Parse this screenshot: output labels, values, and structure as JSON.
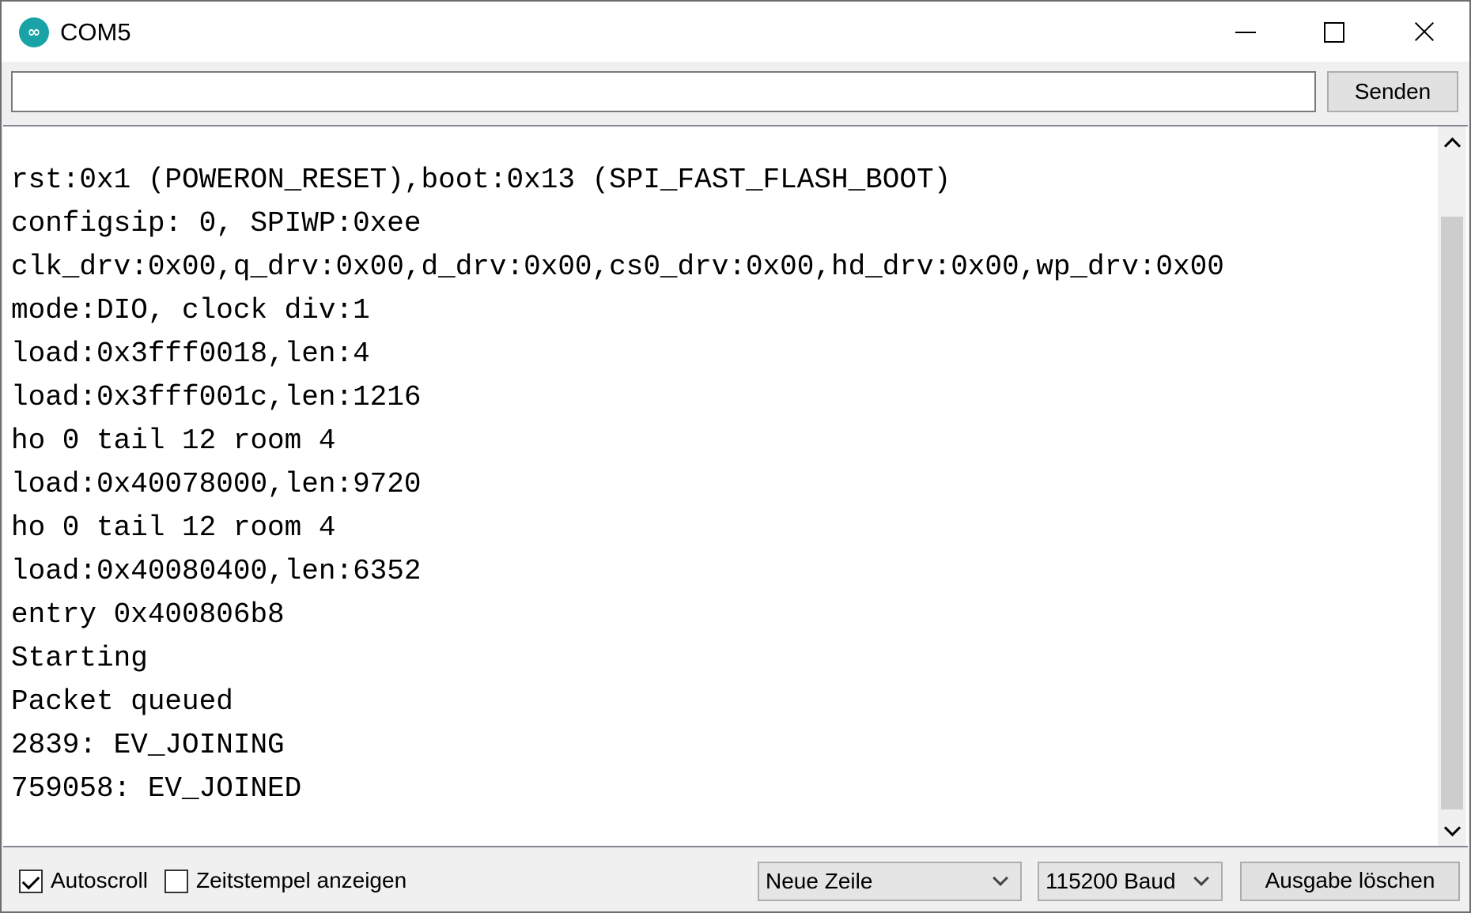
{
  "window": {
    "title": "COM5"
  },
  "toolbar": {
    "input_value": "",
    "send_label": "Senden"
  },
  "console": {
    "lines": [
      "rst:0x1 (POWERON_RESET),boot:0x13 (SPI_FAST_FLASH_BOOT)",
      "configsip: 0, SPIWP:0xee",
      "clk_drv:0x00,q_drv:0x00,d_drv:0x00,cs0_drv:0x00,hd_drv:0x00,wp_drv:0x00",
      "mode:DIO, clock div:1",
      "load:0x3fff0018,len:4",
      "load:0x3fff001c,len:1216",
      "ho 0 tail 12 room 4",
      "load:0x40078000,len:9720",
      "ho 0 tail 12 room 4",
      "load:0x40080400,len:6352",
      "entry 0x400806b8",
      "Starting",
      "Packet queued",
      "2839: EV_JOINING",
      "759058: EV_JOINED"
    ]
  },
  "statusbar": {
    "autoscroll_label": "Autoscroll",
    "autoscroll_checked": true,
    "timestamp_label": "Zeitstempel anzeigen",
    "timestamp_checked": false,
    "line_ending": "Neue Zeile",
    "baud_rate": "115200 Baud",
    "clear_label": "Ausgabe löschen"
  },
  "colors": {
    "app_icon": "#1aa3a6",
    "scroll_thumb": "#cdcdcd",
    "background": "#f0f0f0"
  },
  "icons": [
    "arduino-app-icon",
    "minimize-icon",
    "maximize-icon",
    "close-icon",
    "scroll-up-icon",
    "scroll-down-icon",
    "chevron-down-icon",
    "checkmark-icon"
  ]
}
